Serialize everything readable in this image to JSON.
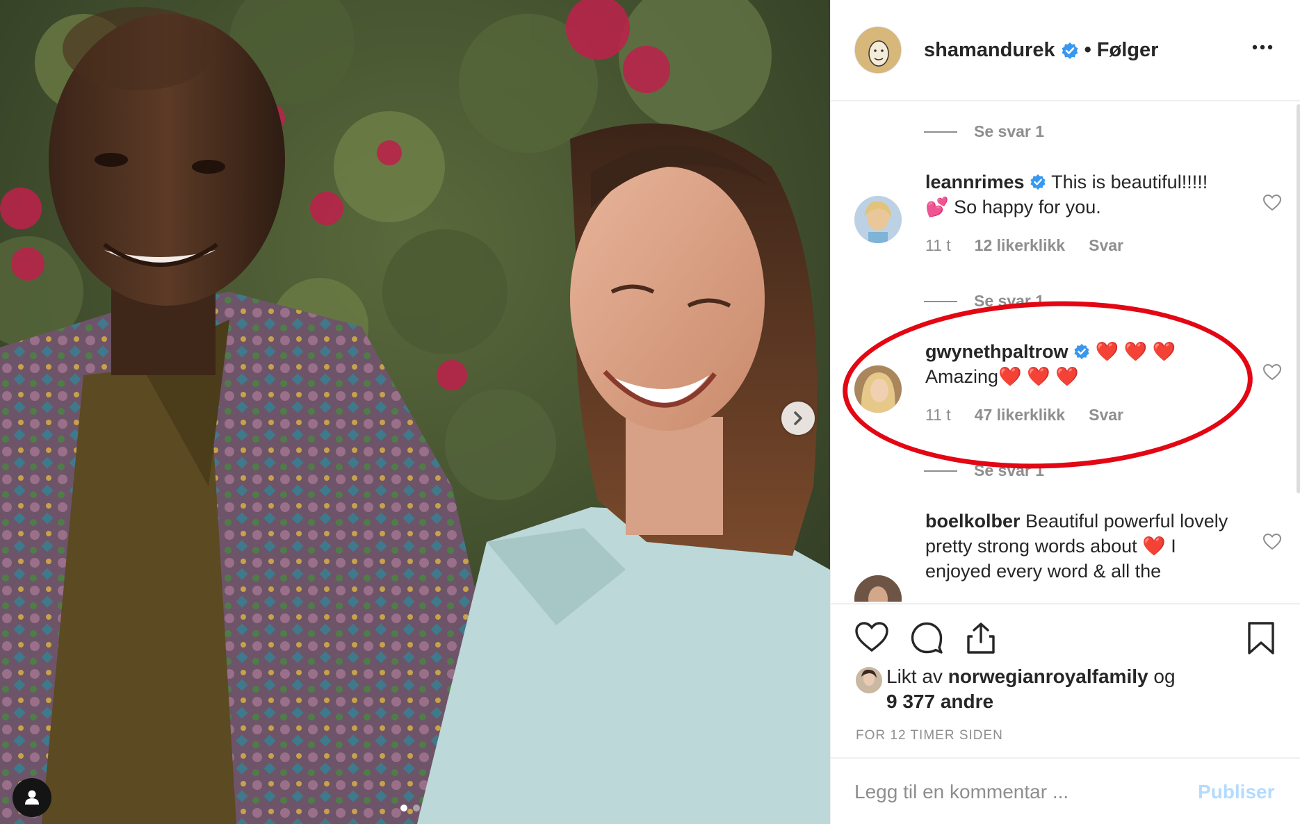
{
  "post": {
    "author": "shamandurek",
    "follow_status": "• Følger",
    "more_icon": "more-horizontal-icon",
    "verified_color": "#3897f0"
  },
  "comments": [
    {
      "see_replies": "Se svar 1"
    },
    {
      "username": "leannrimes",
      "text": "This is beautiful!!!!! 💕 So happy for you.",
      "time": "11 t",
      "likes": "12 likerklikk",
      "reply": "Svar",
      "see_replies": "Se svar 1"
    },
    {
      "username": "gwynethpaltrow",
      "text": "❤️ ❤️ ❤️ Amazing❤️ ❤️ ❤️",
      "time": "11 t",
      "likes": "47 likerklikk",
      "reply": "Svar",
      "see_replies": "Se svar 1"
    },
    {
      "username": "boelkolber",
      "text": "Beautiful powerful lovely pretty strong words about ❤️ I enjoyed every word & all the"
    }
  ],
  "likes": {
    "prefix": "Likt av",
    "by": "norwegianroyalfamily",
    "conj": "og",
    "others": "9 377 andre"
  },
  "time_ago": "FOR 12 TIMER SIDEN",
  "comment_input": {
    "placeholder": "Legg til en kommentar ...",
    "publish": "Publiser"
  },
  "carousel": {
    "current": 1,
    "total": 2
  },
  "colors": {
    "highlight_ring": "#e30613",
    "publish_disabled": "#b3dbff",
    "meta_gray": "#8e8e8e"
  }
}
